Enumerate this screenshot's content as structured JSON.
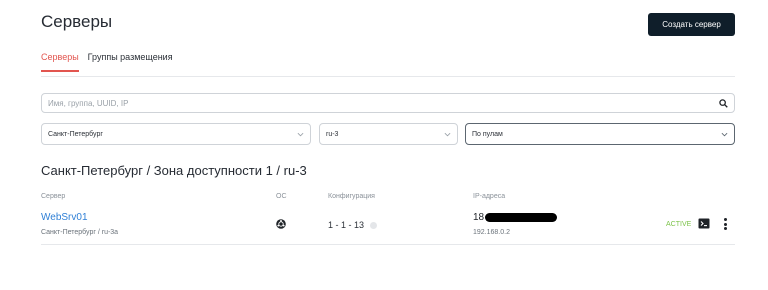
{
  "page": {
    "title": "Серверы",
    "create_button": "Создать сервер"
  },
  "tabs": [
    {
      "label": "Серверы",
      "active": true
    },
    {
      "label": "Группы размещения",
      "active": false
    }
  ],
  "search": {
    "placeholder": "Имя, группа, UUID, IP",
    "icon": "search-icon"
  },
  "filters": {
    "region": "Санкт-Петербург",
    "zone": "ru-3",
    "pool_mode": "По пулам"
  },
  "region_heading": "Санкт-Петербург / Зона доступности 1 / ru-3",
  "table": {
    "headers": [
      "Сервер",
      "ОС",
      "Конфигурация",
      "IP-адреса"
    ],
    "rows": [
      {
        "name": "WebSrv01",
        "location": "Санкт-Петербург / ru-3a",
        "os_icon": "os-logo-icon",
        "config": "1 - 1 - 13",
        "ip_public_prefix": "18",
        "ip_private": "192.168.0.2",
        "status": "ACTIVE"
      }
    ]
  },
  "colors": {
    "accent": "#e2554f",
    "link": "#2e7fd6",
    "status_active": "#7cc34a",
    "primary_button": "#0f1e2a"
  }
}
